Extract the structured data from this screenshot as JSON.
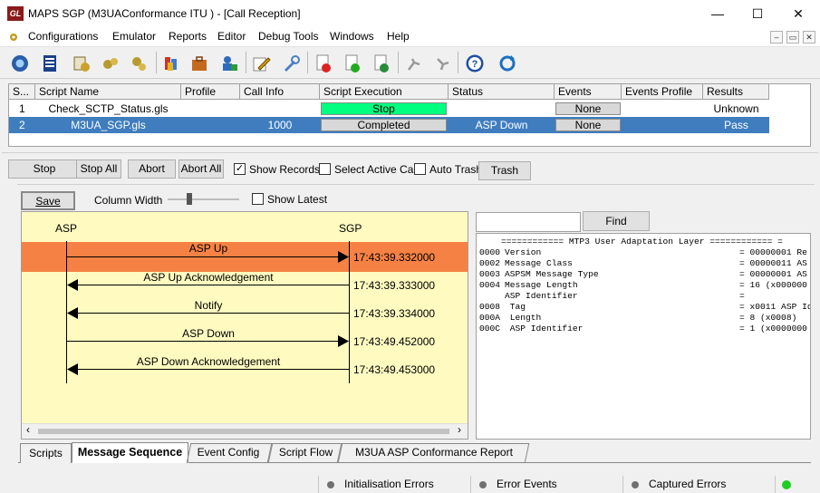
{
  "window": {
    "title": "MAPS SGP (M3UAConformance ITU ) - [Call Reception]",
    "logo_text": "GL",
    "minimize": "—",
    "maximize": "☐",
    "close": "✕"
  },
  "menu": [
    "Configurations",
    "Emulator",
    "Reports",
    "Editor",
    "Debug Tools",
    "Windows",
    "Help"
  ],
  "mdi_controls": [
    "–",
    "▭",
    "✕"
  ],
  "grid": {
    "headers": [
      "S...",
      "Script Name",
      "Profile",
      "Call Info",
      "Script Execution",
      "Status",
      "Events",
      "Events Profile",
      "Results"
    ],
    "rows": [
      {
        "num": "1",
        "script": "Check_SCTP_Status.gls",
        "profile": "",
        "call_info": "",
        "execution": "Stop",
        "status": "",
        "events": "None",
        "events_profile": "",
        "result": "Unknown"
      },
      {
        "num": "2",
        "script": "M3UA_SGP.gls",
        "profile": "",
        "call_info": "1000",
        "execution": "Completed",
        "status": "ASP Down",
        "events": "None",
        "events_profile": "",
        "result": "Pass"
      }
    ]
  },
  "controls": {
    "stop": "Stop",
    "stop_all": "Stop All",
    "abort": "Abort",
    "abort_all": "Abort All",
    "show_records": "Show Records",
    "show_records_checked": "✓",
    "select_active_call": "Select Active Call",
    "auto_trash": "Auto Trash",
    "trash": "Trash",
    "save": "Save",
    "column_width": "Column Width",
    "show_latest": "Show Latest",
    "find": "Find",
    "find_value": ""
  },
  "sequence": {
    "left_entity": "ASP",
    "right_entity": "SGP",
    "messages": [
      {
        "label": "ASP Up",
        "time": "17:43:39.332000",
        "direction": "right",
        "highlighted": true
      },
      {
        "label": "ASP Up Acknowledgement",
        "time": "17:43:39.333000",
        "direction": "left",
        "highlighted": false
      },
      {
        "label": "Notify",
        "time": "17:43:39.334000",
        "direction": "left",
        "highlighted": false
      },
      {
        "label": "ASP Down",
        "time": "17:43:49.452000",
        "direction": "right",
        "highlighted": false
      },
      {
        "label": "ASP Down Acknowledgement",
        "time": "17:43:49.453000",
        "direction": "left",
        "highlighted": false
      }
    ]
  },
  "decode": {
    "title_line": "============ MTP3 User Adaptation Layer ============ =",
    "lines": [
      {
        "off": "0000",
        "field": "Version",
        "value": "= 00000001 Re"
      },
      {
        "off": "0002",
        "field": "Message Class",
        "value": "= 00000011 AS"
      },
      {
        "off": "0003",
        "field": "ASPSM Message Type",
        "value": "= 00000001 AS"
      },
      {
        "off": "0004",
        "field": "Message Length",
        "value": "= 16 (x000000"
      },
      {
        "off": "",
        "field": "ASP Identifier",
        "value": "="
      },
      {
        "off": "0008",
        "field": " Tag",
        "value": "= x0011 ASP Id"
      },
      {
        "off": "000A",
        "field": " Length",
        "value": "= 8 (x0008)"
      },
      {
        "off": "000C",
        "field": " ASP Identifier",
        "value": "= 1 (x0000000"
      }
    ]
  },
  "tabs": [
    "Scripts",
    "Message Sequence",
    "Event Config",
    "Script Flow",
    "M3UA ASP Conformance Report"
  ],
  "active_tab": "Message Sequence",
  "status": [
    "Initialisation Errors",
    "Error Events",
    "Captured Errors"
  ],
  "colors": {
    "selection": "#3f7dbf",
    "stop_green": "#00ff7f",
    "highlight": "#f58244",
    "sequence_bg": "#fffbc0",
    "status_led": "#22cc22"
  },
  "icons": [
    "start-icon",
    "notebook-icon",
    "script-settings-icon",
    "gears-icon",
    "gears-alt-icon",
    "database-icon",
    "briefcase-icon",
    "user-lock-icon",
    "pen-edit-icon",
    "wrench-tool-icon",
    "red-page-icon",
    "green-page-icon",
    "page-p-icon",
    "connect-icon",
    "disconnect-icon",
    "help-icon",
    "refresh-icon"
  ]
}
